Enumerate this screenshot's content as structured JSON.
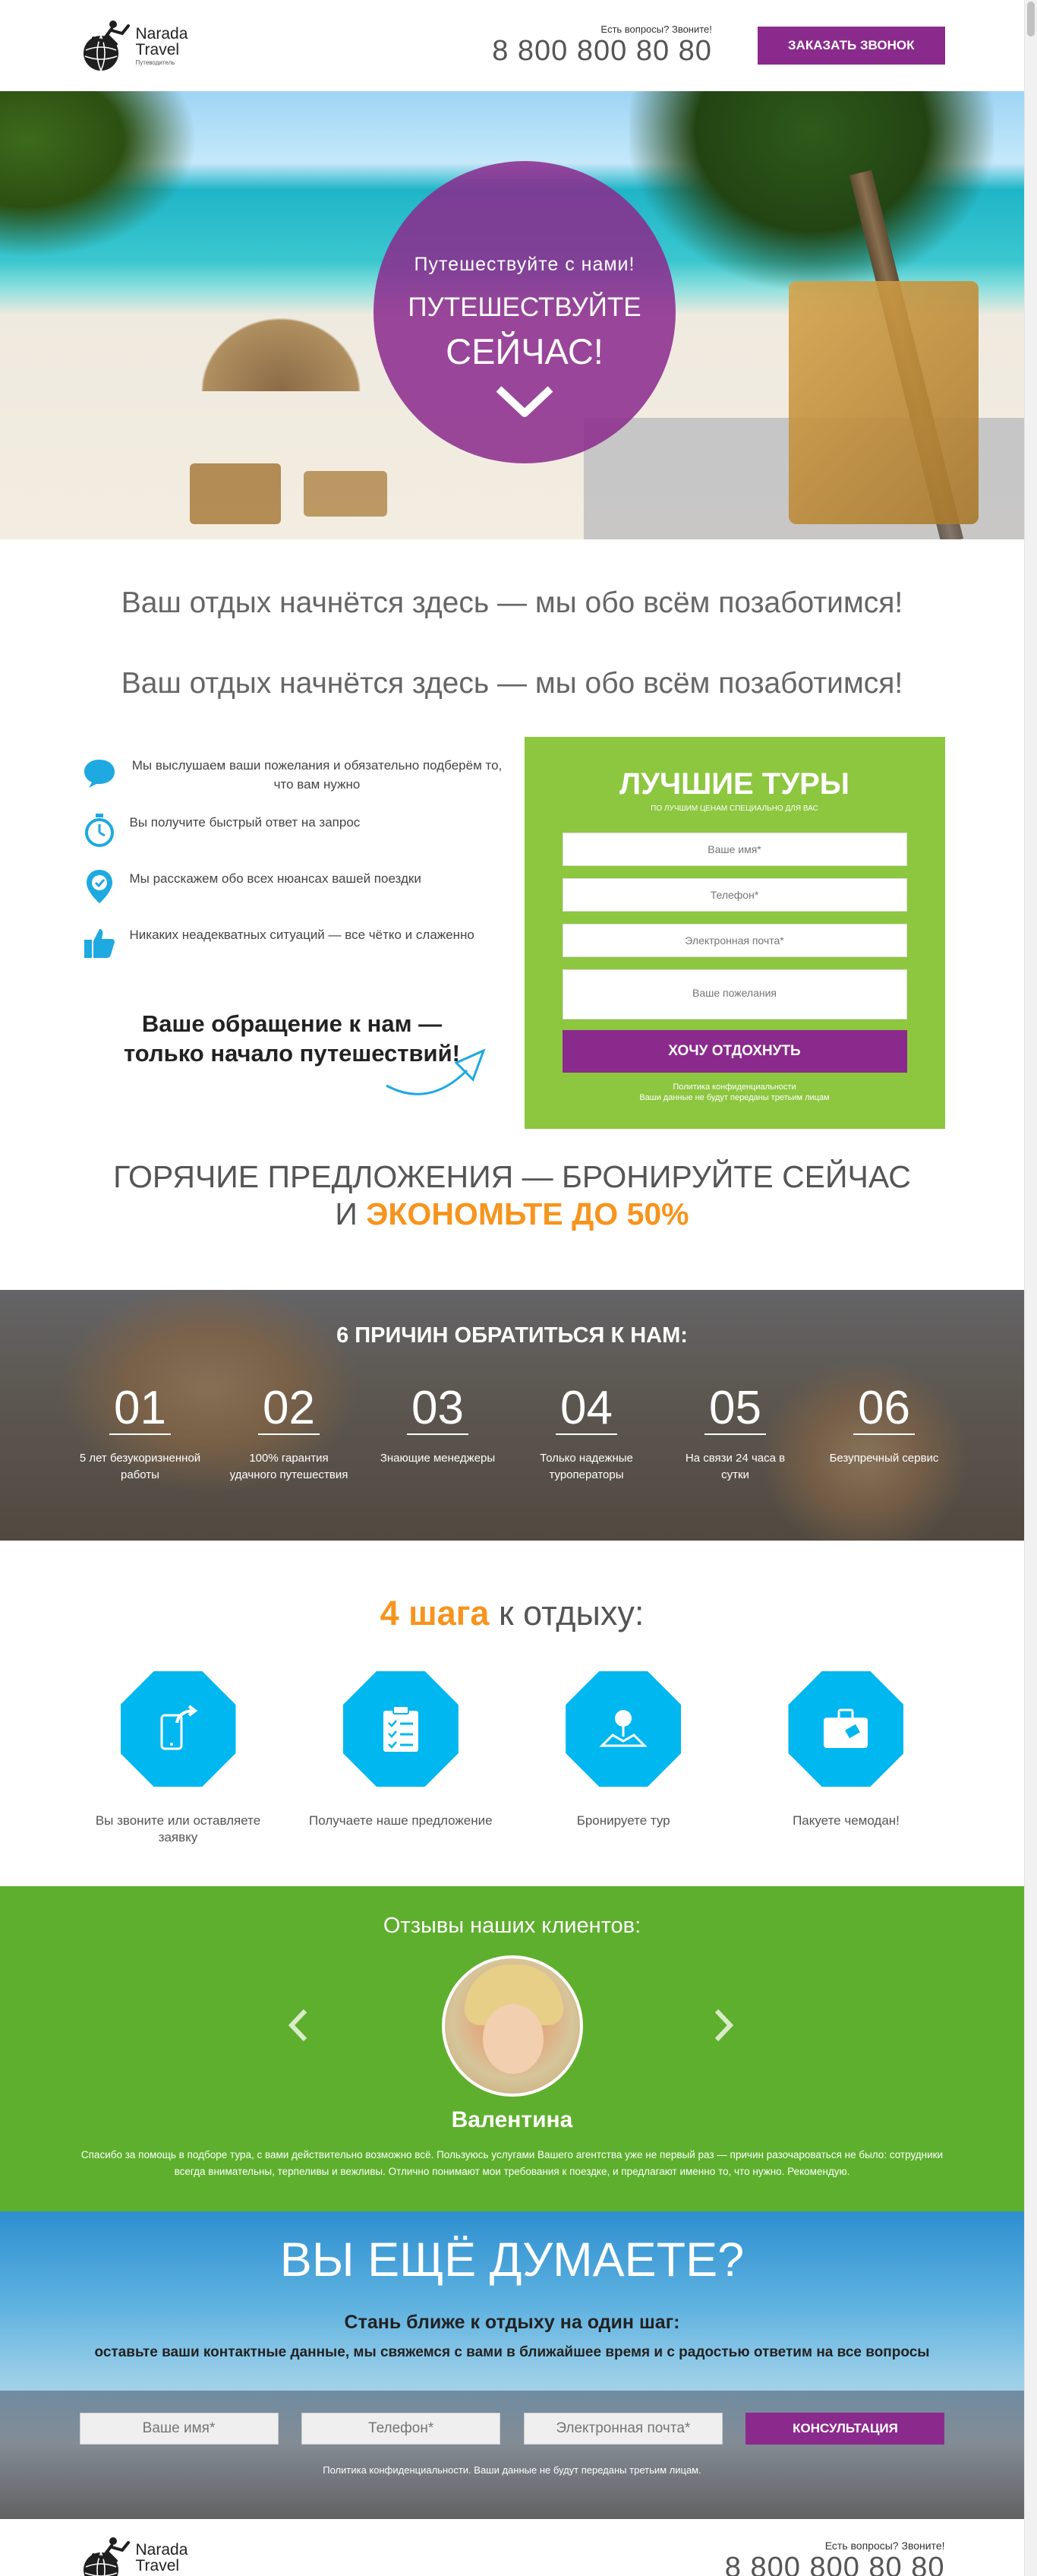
{
  "header": {
    "logo_line1": "Narada",
    "logo_line2": "Travel",
    "logo_line3": "Путеводитель",
    "question": "Есть вопросы? Звоните!",
    "phone": "8 800 800 80 80",
    "callback_button": "Заказать звонок"
  },
  "hero": {
    "subtitle": "Путешествуйте с нами!",
    "title_line1": "Путешествуйте",
    "title_line2": "сейчас!"
  },
  "intro": {
    "heading1": "Ваш отдых начнётся здесь — мы обо всём позаботимся!",
    "heading2": "Ваш отдых начнётся здесь — мы обо всём позаботимся!"
  },
  "features": [
    {
      "icon": "chat-icon",
      "text": "Мы выслушаем ваши пожелания и обязательно подберём то, что вам нужно"
    },
    {
      "icon": "stopwatch-icon",
      "text": "Вы получите быстрый ответ на запрос"
    },
    {
      "icon": "location-check-icon",
      "text": "Мы расскажем обо всех нюансах вашей поездки"
    },
    {
      "icon": "thumbs-up-icon",
      "text": "Никаких неадекватных ситуаций — все чётко и слаженно"
    }
  ],
  "tagline": {
    "line1": "Ваше обращение к нам —",
    "line2": "только начало путешествий!"
  },
  "tour_form": {
    "title": "Лучшие туры",
    "subtitle": "по лучшим ценам специально для вас",
    "name_placeholder": "Ваше имя*",
    "phone_placeholder": "Телефон*",
    "email_placeholder": "Электронная почта*",
    "wishes_placeholder": "Ваше пожелания",
    "submit": "Хочу отдохнуть",
    "policy_line1": "Политика конфиденциальности",
    "policy_line2": "Ваши данные не будут переданы третьим лицам"
  },
  "hot_offers": {
    "line1": "Горячие предложения — бронируйте сейчас",
    "line2_prefix": "и",
    "line2_highlight": "экономьте до 50%"
  },
  "reasons": {
    "title": "6 причин обратиться к нам:",
    "items": [
      {
        "number": "01",
        "text": "5 лет безукоризненной работы"
      },
      {
        "number": "02",
        "text": "100% гарантия удачного путешествия"
      },
      {
        "number": "03",
        "text": "Знающие менеджеры"
      },
      {
        "number": "04",
        "text": "Только надежные туроператоры"
      },
      {
        "number": "05",
        "text": "На связи 24 часа в сутки"
      },
      {
        "number": "06",
        "text": "Безупречный сервис"
      }
    ]
  },
  "steps": {
    "title_highlight": "4 шага",
    "title_rest": "к отдыху:",
    "items": [
      {
        "icon": "phone-share-icon",
        "text": "Вы звоните или оставляете заявку"
      },
      {
        "icon": "clipboard-check-icon",
        "text": "Получаете наше предложение"
      },
      {
        "icon": "location-person-icon",
        "text": "Бронируете тур"
      },
      {
        "icon": "suitcase-icon",
        "text": "Пакуете чемодан!"
      }
    ]
  },
  "reviews": {
    "title": "Отзывы наших клиентов:",
    "name": "Валентина",
    "text": "Спасибо за помощь в подборе тура, с вами действительно возможно всё. Пользуюсь услугами Вашего агентства уже не первый раз — причин разочароваться не было: сотрудники всегда внимательны, терпеливы и вежливы. Отлично понимают мои требования к поездке, и предлагают именно то, что нужно. Рекомендую."
  },
  "think": {
    "title": "Вы ещё думаете?",
    "subtitle1": "Стань ближе к отдыху на один шаг:",
    "subtitle2": "оставьте ваши контактные данные, мы свяжемся с вами в ближайшее время и с радостью ответим на все вопросы",
    "name_placeholder": "Ваше имя*",
    "phone_placeholder": "Телефон*",
    "email_placeholder": "Электронная почта*",
    "button": "Консультация",
    "policy": "Политика конфиденциальности. Ваши данные не будут переданы третьим лицам."
  },
  "footer": {
    "question": "Есть вопросы? Звоните!",
    "phone": "8 800 800 80 80"
  },
  "colors": {
    "purple": "#8b2a8d",
    "green": "#8dc63f",
    "dark_green": "#5eaf2d",
    "orange": "#f7941d",
    "blue": "#00b7ef"
  }
}
